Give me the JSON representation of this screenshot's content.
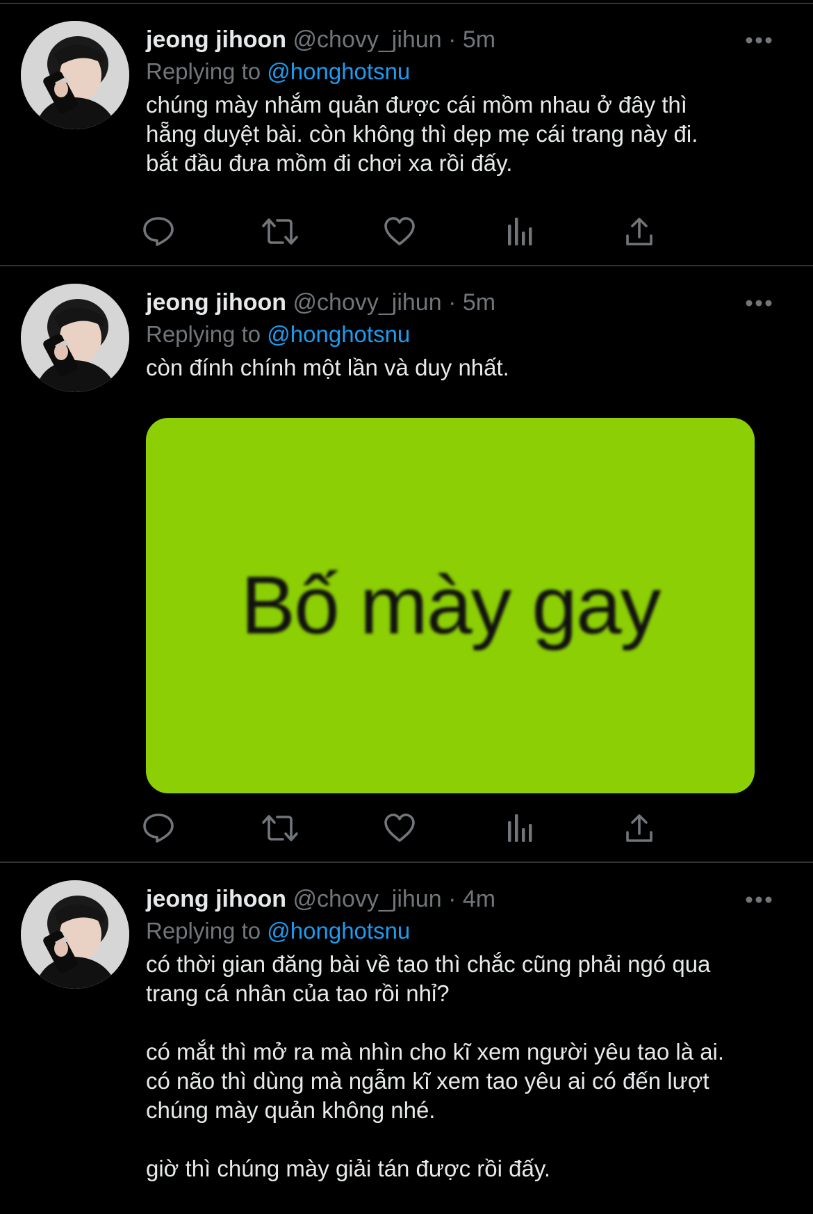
{
  "colors": {
    "background": "#000000",
    "divider": "#2f3336",
    "primary_text": "#e7e9ea",
    "secondary_text": "#71767b",
    "link": "#1d9bf0",
    "media_bg": "#8ccf05"
  },
  "icons": {
    "more": "more-horizontal-icon",
    "reply": "reply-bubble-icon",
    "retweet": "retweet-icon",
    "like": "heart-icon",
    "views": "analytics-bars-icon",
    "share": "share-upload-icon"
  },
  "tweets": [
    {
      "display_name": "jeong jihoon",
      "handle": "@chovy_jihun",
      "separator": "·",
      "time": "5m",
      "replying_label": "Replying to",
      "replying_to": "@honghotsnu",
      "text": "chúng mày nhắm quản được cái mồm nhau ở đây thì\nhẵng duyệt bài. còn không thì dẹp mẹ cái trang này đi.\nbắt đầu đưa mồm đi chơi xa rồi đấy."
    },
    {
      "display_name": "jeong jihoon",
      "handle": "@chovy_jihun",
      "separator": "·",
      "time": "5m",
      "replying_label": "Replying to",
      "replying_to": "@honghotsnu",
      "text": "còn đính chính một lần và duy nhất.",
      "media_text": "Bố mày gay"
    },
    {
      "display_name": "jeong jihoon",
      "handle": "@chovy_jihun",
      "separator": "·",
      "time": "4m",
      "replying_label": "Replying to",
      "replying_to": "@honghotsnu",
      "text": "có thời gian đăng bài về tao thì chắc cũng phải ngó qua\ntrang cá nhân của tao rồi nhỉ?\n\ncó mắt thì mở ra mà nhìn cho kĩ xem người yêu tao là ai.\ncó não thì dùng mà ngẫm kĩ xem tao yêu ai có đến lượt\nchúng mày quản không nhé.\n\ngiờ thì chúng mày giải tán được rồi đấy."
    }
  ]
}
